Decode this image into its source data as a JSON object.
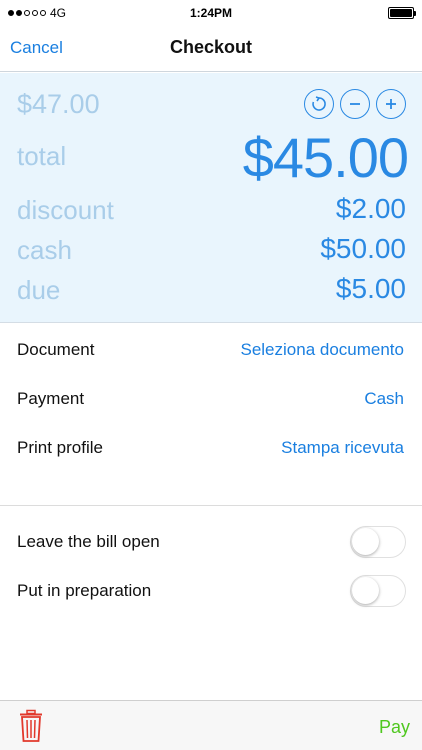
{
  "status_bar": {
    "carrier": "4G",
    "time": "1:24PM"
  },
  "nav": {
    "cancel_label": "Cancel",
    "title": "Checkout"
  },
  "summary": {
    "original_amount": "$47.00",
    "total_label": "total",
    "total_value": "$45.00",
    "discount_label": "discount",
    "discount_value": "$2.00",
    "cash_label": "cash",
    "cash_value": "$50.00",
    "due_label": "due",
    "due_value": "$5.00",
    "icons": [
      "reset-icon",
      "minus-icon",
      "plus-icon"
    ]
  },
  "settings": {
    "document_label": "Document",
    "document_value": "Seleziona documento",
    "payment_label": "Payment",
    "payment_value": "Cash",
    "print_profile_label": "Print profile",
    "print_profile_value": "Stampa ricevuta"
  },
  "toggles": {
    "leave_open_label": "Leave the bill open",
    "leave_open_on": false,
    "preparation_label": "Put in preparation",
    "preparation_on": false
  },
  "toolbar": {
    "pay_label": "Pay",
    "trash_icon": "trash-icon"
  },
  "colors": {
    "accent": "#1a7fe0",
    "muted": "#a9cde9",
    "panel": "#e9f5fd",
    "pay": "#4fc71f",
    "trash": "#e2382b"
  }
}
